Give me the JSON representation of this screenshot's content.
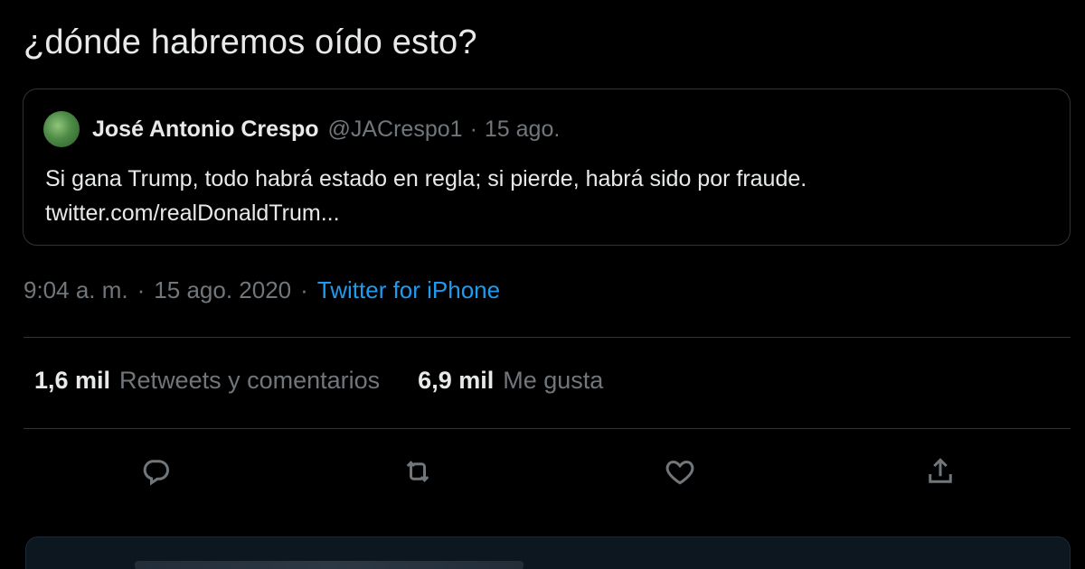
{
  "tweet": {
    "text": "¿dónde habremos oído esto?",
    "time": "9:04 a. m.",
    "separator": "·",
    "date": "15 ago. 2020",
    "source": "Twitter for iPhone"
  },
  "quote": {
    "name": "José Antonio Crespo",
    "handle": "@JACrespo1",
    "separator": "·",
    "date": "15 ago.",
    "body_line1": "Si gana Trump, todo habrá estado en regla; si pierde, habrá sido por fraude.",
    "body_line2": "twitter.com/realDonaldTrum..."
  },
  "stats": {
    "retweets_count": "1,6 mil",
    "retweets_label": "Retweets y comentarios",
    "likes_count": "6,9 mil",
    "likes_label": "Me gusta"
  },
  "actions": {
    "reply_icon": "reply-icon",
    "retweet_icon": "retweet-icon",
    "like_icon": "heart-icon",
    "share_icon": "share-icon"
  },
  "colors": {
    "background": "#000000",
    "text": "#e7e9ea",
    "muted": "#71767b",
    "link": "#1d9bf0",
    "border": "#2f3336"
  }
}
